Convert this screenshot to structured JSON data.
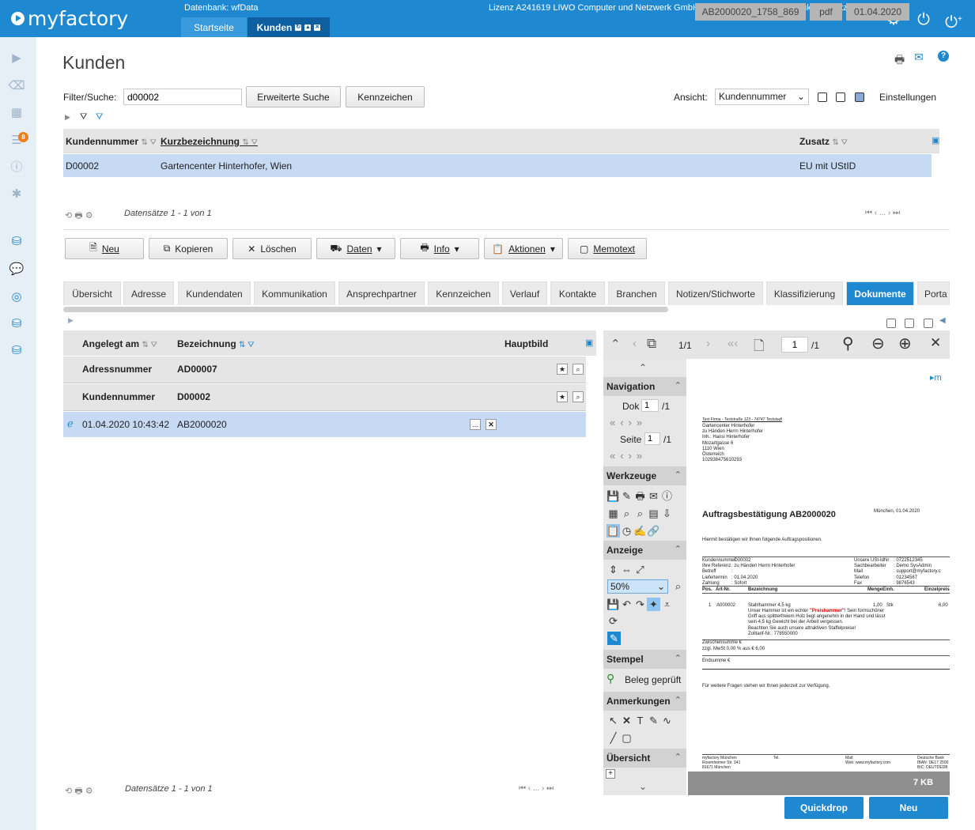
{
  "app": {
    "logo": "myfactory",
    "database": "Datenbank: wfData",
    "license": "Lizenz A241619 LIWO Computer und Netzwerk GmbH - Partnerlizenz - kein Produktiveinsatz bei Kunden"
  },
  "top_tabs": [
    {
      "label": "Startseite"
    },
    {
      "label": "Kunden"
    }
  ],
  "page": {
    "title": "Kunden"
  },
  "filter": {
    "label": "Filter/Suche:",
    "value": "d00002",
    "advanced_button": "Erweiterte Suche",
    "flags_button": "Kennzeichen",
    "view_label": "Ansicht:",
    "view_value": "Kundennummer",
    "settings_label": "Einstellungen"
  },
  "customer_grid": {
    "columns": [
      "Kundennummer",
      "Kurzbezeichnung",
      "Zusatz"
    ],
    "rows": [
      {
        "number": "D00002",
        "name": "Gartencenter Hinterhofer, Wien",
        "extra": "EU mit UStID"
      }
    ],
    "records": "Datensätze 1 - 1 von 1",
    "pager_dots": "..."
  },
  "actions": [
    "Neu",
    "Kopieren",
    "Löschen",
    "Daten",
    "Info",
    "Aktionen",
    "Memotext"
  ],
  "tabs": [
    "Übersicht",
    "Adresse",
    "Kundendaten",
    "Kommunikation",
    "Ansprechpartner",
    "Kennzeichen",
    "Verlauf",
    "Kontakte",
    "Branchen",
    "Notizen/Stichworte",
    "Klassifizierung",
    "Dokumente",
    "Porta"
  ],
  "active_tab": "Dokumente",
  "doc_grid": {
    "columns": [
      "Angelegt am",
      "Bezeichnung",
      "Hauptbild"
    ],
    "groups": [
      {
        "label": "Adressnummer",
        "value": "AD00007"
      },
      {
        "label": "Kundennummer",
        "value": "D00002"
      }
    ],
    "rows": [
      {
        "date": "01.04.2020 10:43:42",
        "name": "AB2000020",
        "more": "..."
      }
    ],
    "records": "Datensätze 1 - 1 von 1",
    "pager_dots": "..."
  },
  "viewer": {
    "layers": "1/1",
    "page_input": "1",
    "page_total": "/1",
    "nav": {
      "title": "Navigation",
      "dok_label": "Dok",
      "dok_value": "1",
      "dok_total": "/1",
      "seite_label": "Seite",
      "seite_value": "1",
      "seite_total": "/1"
    },
    "sections": [
      "Werkzeuge",
      "Anzeige",
      "Stempel",
      "Anmerkungen",
      "Übersicht"
    ],
    "zoom": "50%",
    "stamp": "Beleg geprüft",
    "footer": {
      "file": "AB2000020_1758_869",
      "type": "pdf",
      "date": "01.04.2020",
      "size": "7 KB"
    }
  },
  "document": {
    "logo": "m",
    "sender_line": "Test Firma - Teststraße 123 - 74747 Teststadt",
    "address": [
      "Gartencenter Hinterhofer",
      "zu Händen Herrn Hinterhofer",
      "Inh.: Hansi Hinterhofer",
      "Mozartgasse 6",
      "1110 Wien",
      "Österreich",
      "102938475610293"
    ],
    "heading": "Auftragsbestätigung AB2000020",
    "place_date": "München, 01.04.2020",
    "intro": "Hiermit bestätigen wir Ihnen folgende Auftragspositionen.",
    "info_left": [
      [
        "Kundennummer",
        ": D00002"
      ],
      [
        "Ihre Referenz",
        ": zu Händen Herrn Hinterhofer"
      ],
      [
        "Betreff",
        ":"
      ],
      [
        "Liefertermin",
        ": 01.04.2020"
      ],
      [
        "Zahlung",
        ": Sofort"
      ]
    ],
    "info_right": [
      [
        "Unsere USt-IdNr",
        ": 0722512345"
      ],
      [
        "Sachbearbeiter",
        ": Demo SysAdmin"
      ],
      [
        "Mail",
        ": support@myfactory.c"
      ],
      [
        "Telefon",
        ": 01234567"
      ],
      [
        "Fax",
        ": 9876543"
      ]
    ],
    "table_head": [
      "Pos.",
      "Art-Nr.",
      "Bezeichnung",
      "Menge",
      "Einh.",
      "Einzelpreis"
    ],
    "item": {
      "pos": "1",
      "art": "A000002",
      "name": "Stahlhammer 4,5 kg",
      "qty": "1,00",
      "unit": "Stk",
      "price": "6,00"
    },
    "desc_pre": "Unser Hammer ist ein echter ",
    "desc_red": "\"Preishammer\"",
    "desc_post": "! Sein formschöner",
    "desc_lines": [
      "Griff aus splitterfreiem Holz liegt angenehm in der Hand und lässt",
      "sein 4,5 kg Gewicht bei der Arbeit vergessen.",
      "Beachten Sie auch unsere attraktiven Staffelpreise!",
      "Zolltarif-Nr.: 778550000"
    ],
    "subtotal": "Zwischensumme €",
    "vat": "zzgl. MwSt 0,00 % aus € 6,00",
    "total": "Endsumme €",
    "closing": "Für weitere Fragen stehen wir Ihnen jederzeit zur Verfügung.",
    "footer_cols": [
      [
        "myfactory München",
        "Rosenheimer Str. 141",
        "81671 München"
      ],
      [
        "Tel."
      ],
      [
        "Mail:",
        "Web: www.myfactory.com"
      ],
      [
        "Deutsche Bank",
        "IBAN: DE17 2500",
        "BIC: DEUTDEDB"
      ]
    ]
  },
  "bottom_buttons": {
    "quickdrop": "Quickdrop",
    "new": "Neu"
  }
}
